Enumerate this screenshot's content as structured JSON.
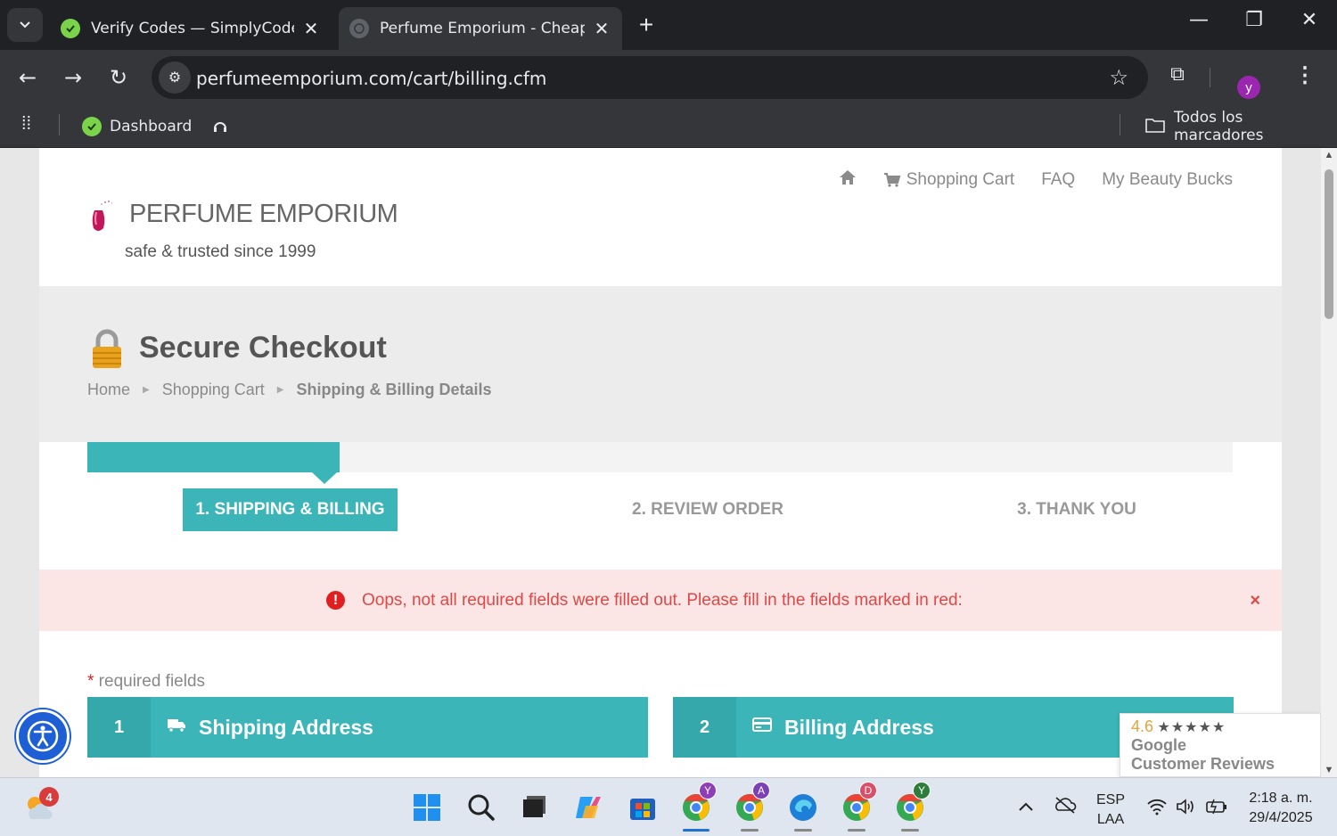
{
  "browser": {
    "tabs": [
      {
        "title": "Verify Codes — SimplyCodes",
        "active": false
      },
      {
        "title": "Perfume Emporium - Cheap Per",
        "active": true
      }
    ],
    "url": "perfumeemporium.com/cart/billing.cfm",
    "profile_initial": "y",
    "bookmarks": [
      {
        "label": "Dashboard"
      },
      {
        "label": ""
      }
    ],
    "all_bookmarks_label": "Todos los marcadores"
  },
  "site": {
    "nav": {
      "shopping_cart": "Shopping Cart",
      "faq": "FAQ",
      "beauty_bucks": "My Beauty Bucks"
    },
    "logo_text": "PERFUME EMPORIUM",
    "tagline": "safe & trusted since 1999"
  },
  "checkout": {
    "title": "Secure Checkout",
    "breadcrumb": [
      "Home",
      "Shopping Cart",
      "Shipping & Billing Details"
    ],
    "progress_fraction": 0.22,
    "steps": [
      {
        "label": "1. SHIPPING & BILLING",
        "active": true
      },
      {
        "label": "2. REVIEW ORDER",
        "active": false
      },
      {
        "label": "3. THANK YOU",
        "active": false
      }
    ],
    "alert": {
      "icon": "!",
      "message": "Oops, not all required fields were filled out. Please fill in the fields marked in red:",
      "close": "×"
    },
    "required_note": {
      "star": "*",
      "text": " required fields"
    },
    "sections": [
      {
        "number": "1",
        "icon": "truck-icon",
        "title": "Shipping Address"
      },
      {
        "number": "2",
        "icon": "credit-card-icon",
        "title": "Billing Address"
      }
    ]
  },
  "reviews_badge": {
    "score": "4.6",
    "stars": "★★★★★",
    "line1": "Google",
    "line2": "Customer Reviews"
  },
  "taskbar": {
    "weather_badge": "4",
    "apps": [
      {
        "name": "windows-start"
      },
      {
        "name": "search"
      },
      {
        "name": "file-explorer"
      },
      {
        "name": "copilot"
      },
      {
        "name": "microsoft-store"
      },
      {
        "name": "chrome",
        "badge": "Y",
        "badge_color": "#8e3fb6"
      },
      {
        "name": "chrome",
        "badge": "A",
        "badge_color": "#7b3fb6"
      },
      {
        "name": "edge-like"
      },
      {
        "name": "chrome",
        "badge": "D",
        "badge_color": "#d94f6a"
      },
      {
        "name": "chrome",
        "badge": "Y",
        "badge_color": "#2f7d3a"
      }
    ],
    "language": {
      "line1": "ESP",
      "line2": "LAA"
    },
    "clock": {
      "time": "2:18 a. m.",
      "date": "29/4/2025"
    }
  },
  "colors": {
    "teal": "#3cb5b8",
    "alert_bg": "#fbe5e5",
    "alert_text": "#e04848"
  }
}
